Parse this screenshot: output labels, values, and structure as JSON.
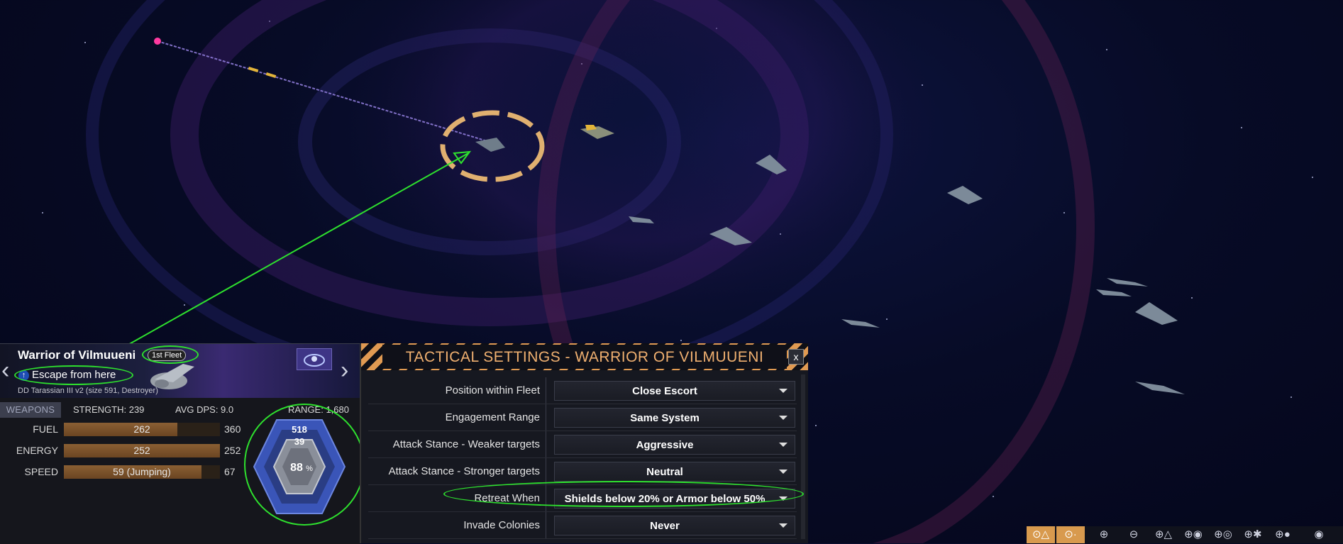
{
  "ship": {
    "name": "Warrior of Vilmuueni",
    "fleet": "1st Fleet",
    "order": "Escape from here",
    "class_line": "DD Tarassian III v2 (size 591, Destroyer)",
    "prev_icon": "chevron-left-icon",
    "next_icon": "chevron-right-icon"
  },
  "stats": {
    "weapons_tab": "WEAPONS",
    "strength": "STRENGTH: 239",
    "avg_dps": "AVG DPS: 9.0",
    "range": "RANGE: 1,680"
  },
  "resources": [
    {
      "label": "FUEL",
      "value": "262",
      "max": "360",
      "fraction": 0.728
    },
    {
      "label": "ENERGY",
      "value": "252",
      "max": "252",
      "fraction": 1.0
    },
    {
      "label": "SPEED",
      "value": "59 (Jumping)",
      "max": "67",
      "fraction": 0.88
    }
  ],
  "defense": {
    "shields": "518",
    "armor": "39",
    "hull_percent": "88",
    "percent_sign": "%"
  },
  "tactical": {
    "title": "TACTICAL SETTINGS - WARRIOR OF VILMUUENI",
    "close": "x",
    "rows": [
      {
        "label": "Position within Fleet",
        "value": "Close Escort"
      },
      {
        "label": "Engagement Range",
        "value": "Same System"
      },
      {
        "label": "Attack Stance - Weaker targets",
        "value": "Aggressive"
      },
      {
        "label": "Attack Stance - Stronger targets",
        "value": "Neutral"
      },
      {
        "label": "Retreat When",
        "value": "Shields below 20% or Armor below 50%"
      },
      {
        "label": "Invade Colonies",
        "value": "Never"
      }
    ]
  },
  "toolbar_icons": [
    "ships-filter-icon",
    "waypoint-filter-icon",
    "zoom-in-icon",
    "zoom-out-icon",
    "zoom-to-ships-icon",
    "zoom-to-planet-icon",
    "view-ships-icon",
    "view-stations-icon",
    "view-planets-icon",
    "eye-icon"
  ],
  "colors": {
    "accent": "#e09a52",
    "highlight": "#2ee02e",
    "bar_fill": "#8a5f33",
    "title_text": "#f0b070"
  }
}
